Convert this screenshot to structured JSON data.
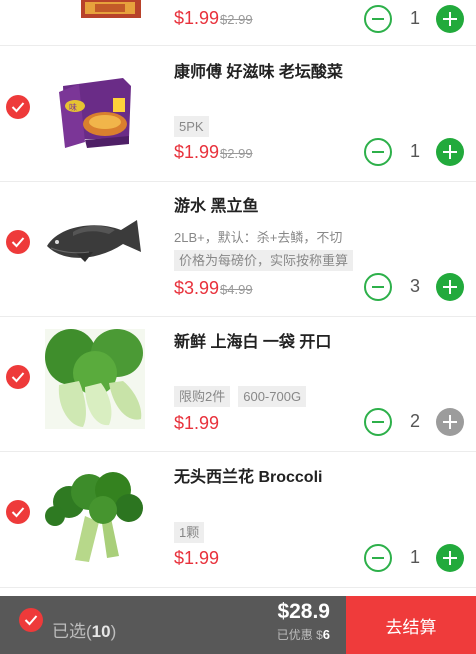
{
  "items": [
    {
      "title": "",
      "price": "$1.99",
      "original_price": "$2.99",
      "quantity": "1",
      "selected": true,
      "plus_enabled": true
    },
    {
      "title": "康师傅 好滋味 老坛酸菜",
      "tags": [
        "5PK"
      ],
      "price": "$1.99",
      "original_price": "$2.99",
      "quantity": "1",
      "selected": true,
      "plus_enabled": true
    },
    {
      "title": "游水 黑立鱼",
      "subtitle": "2LB+，默认：杀+去鳞，不切",
      "tags": [
        "价格为每磅价，实际按称重算"
      ],
      "price": "$3.99",
      "original_price": "$4.99",
      "quantity": "3",
      "selected": true,
      "plus_enabled": true
    },
    {
      "title": "新鲜 上海白 一袋 开口",
      "tags": [
        "限购2件",
        "600-700G"
      ],
      "price": "$1.99",
      "quantity": "2",
      "selected": true,
      "plus_enabled": false
    },
    {
      "title": "无头西兰花 Broccoli",
      "tags": [
        "1颗"
      ],
      "price": "$1.99",
      "quantity": "1",
      "selected": true,
      "plus_enabled": true
    }
  ],
  "footer": {
    "selected_label": "已选",
    "selected_count": "10",
    "total": "$28.9",
    "saved_label": "已优惠 $",
    "saved_amount": "6",
    "checkout_label": "去结算"
  },
  "colors": {
    "accent_red": "#ee3a3a",
    "price_red": "#e8323c",
    "green": "#22aa3c",
    "footer_bg": "#585858"
  },
  "icons": {
    "select": "check-circle-icon",
    "decrease": "minus-circle-icon",
    "increase": "plus-circle-icon"
  }
}
